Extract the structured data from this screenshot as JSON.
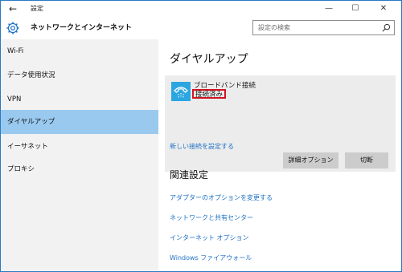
{
  "window": {
    "title": "設定",
    "back_glyph": "←",
    "minimize_glyph": "—",
    "maximize_glyph": "☐",
    "close_glyph": "✕"
  },
  "header": {
    "title": "ネットワークとインターネット",
    "search_placeholder": "設定の検索"
  },
  "sidebar": {
    "items": [
      {
        "label": "Wi-Fi",
        "selected": false
      },
      {
        "label": "データ使用状況",
        "selected": false
      },
      {
        "label": "VPN",
        "selected": false
      },
      {
        "label": "ダイヤルアップ",
        "selected": true
      },
      {
        "label": "イーサネット",
        "selected": false
      },
      {
        "label": "プロキシ",
        "selected": false
      }
    ]
  },
  "main": {
    "title": "ダイヤルアップ",
    "connection": {
      "name": "ブロードバンド接続",
      "status": "接続済み",
      "buttons": {
        "details": "詳細オプション",
        "disconnect": "切断"
      }
    },
    "new_connection_link": "新しい接続を設定する",
    "related": {
      "title": "関連設定",
      "links": [
        "アダプターのオプションを変更する",
        "ネットワークと共有センター",
        "インターネット オプション",
        "Windows ファイアウォール"
      ]
    }
  },
  "colors": {
    "accent": "#2b79c2",
    "selected_bg": "#99c9ef",
    "link": "#1f72c4",
    "highlight_border": "#d3141f",
    "icon_bg": "#2ca6e0"
  }
}
